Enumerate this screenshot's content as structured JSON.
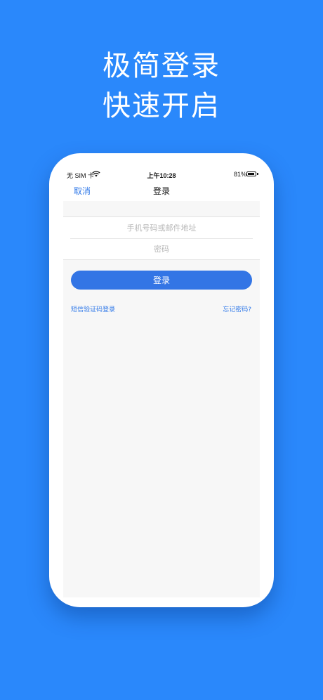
{
  "promo": {
    "line1": "极简登录",
    "line2": "快速开启"
  },
  "status_bar": {
    "carrier": "无 SIM 卡",
    "time": "上午10:28",
    "battery": "81%",
    "battery_level": 0.81
  },
  "nav": {
    "cancel": "取消",
    "title": "登录"
  },
  "form": {
    "account_placeholder": "手机号码或邮件地址",
    "password_placeholder": "密码",
    "login_button": "登录"
  },
  "links": {
    "sms_login": "短信验证码登录",
    "forgot_password": "忘记密码?"
  },
  "colors": {
    "background": "#2a88fb",
    "accent": "#3375e5"
  }
}
